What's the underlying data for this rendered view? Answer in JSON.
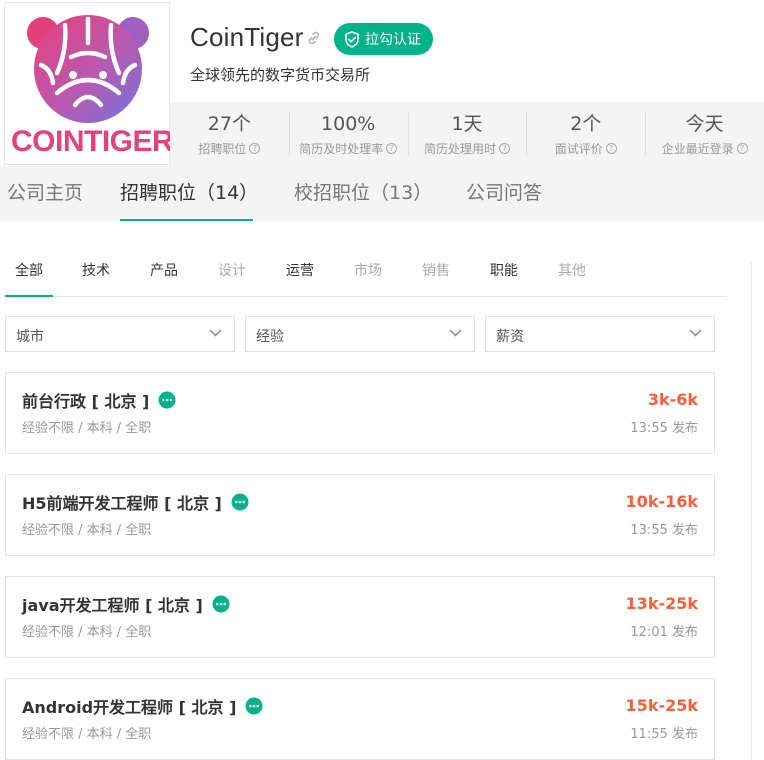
{
  "company": {
    "logo_text_left": "COIN",
    "logo_text_right": "TIGER",
    "name": "CoinTiger",
    "badge": "拉勾认证",
    "tagline": "全球领先的数字货币交易所",
    "colors": {
      "accent": "#00b38a",
      "salary": "#fd5f39",
      "logo_pink": "#e6417a",
      "logo_purple": "#7d6ad3"
    }
  },
  "stats": [
    {
      "value": "27个",
      "label": "招聘职位"
    },
    {
      "value": "100%",
      "label": "简历及时处理率"
    },
    {
      "value": "1天",
      "label": "简历处理用时"
    },
    {
      "value": "2个",
      "label": "面试评价"
    },
    {
      "value": "今天",
      "label": "企业最近登录"
    }
  ],
  "nav": [
    {
      "label": "公司主页",
      "active": false
    },
    {
      "label": "招聘职位（14）",
      "active": true
    },
    {
      "label": "校招职位（13）",
      "active": false
    },
    {
      "label": "公司问答",
      "active": false
    }
  ],
  "categories": [
    {
      "label": "全部",
      "state": "active"
    },
    {
      "label": "技术",
      "state": "normal"
    },
    {
      "label": "产品",
      "state": "normal"
    },
    {
      "label": "设计",
      "state": "disabled"
    },
    {
      "label": "运营",
      "state": "normal"
    },
    {
      "label": "市场",
      "state": "disabled"
    },
    {
      "label": "销售",
      "state": "disabled"
    },
    {
      "label": "职能",
      "state": "normal"
    },
    {
      "label": "其他",
      "state": "disabled"
    }
  ],
  "filters": [
    {
      "label": "城市"
    },
    {
      "label": "经验"
    },
    {
      "label": "薪资"
    }
  ],
  "jobs": [
    {
      "title": "前台行政 [ 北京 ]",
      "meta": "经验不限 / 本科 / 全职",
      "salary": "3k-6k",
      "posted": "13:55 发布"
    },
    {
      "title": "H5前端开发工程师 [ 北京 ]",
      "meta": "经验不限 / 本科 / 全职",
      "salary": "10k-16k",
      "posted": "13:55 发布"
    },
    {
      "title": "java开发工程师 [ 北京 ]",
      "meta": "经验不限 / 本科 / 全职",
      "salary": "13k-25k",
      "posted": "12:01 发布"
    },
    {
      "title": "Android开发工程师 [ 北京 ]",
      "meta": "经验不限 / 本科 / 全职",
      "salary": "15k-25k",
      "posted": "11:55 发布"
    }
  ]
}
